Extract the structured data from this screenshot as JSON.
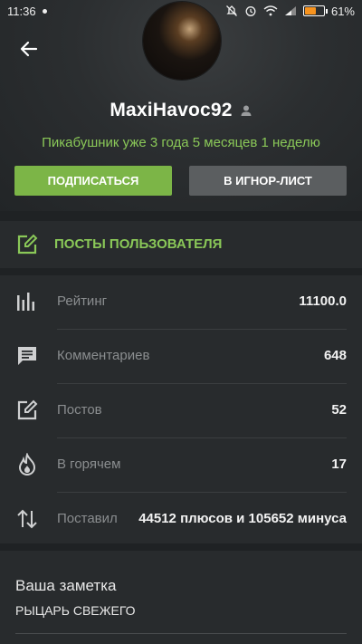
{
  "status_bar": {
    "time": "11:36",
    "battery_percent": "61%",
    "battery_level": 0.61,
    "battery_color": "#f7931e"
  },
  "profile": {
    "username": "MaxiHavoc92",
    "membership": "Пикабушник уже 3 года 5 месяцев 1 неделю",
    "subscribe_label": "ПОДПИСАТЬСЯ",
    "ignore_label": "В ИГНОР-ЛИСТ"
  },
  "posts_link": {
    "label": "ПОСТЫ ПОЛЬЗОВАТЕЛЯ"
  },
  "stats": [
    {
      "label": "Рейтинг",
      "value": "11100.0",
      "icon": "rating-bars-icon"
    },
    {
      "label": "Комментариев",
      "value": "648",
      "icon": "comment-icon"
    },
    {
      "label": "Постов",
      "value": "52",
      "icon": "edit-post-icon"
    },
    {
      "label": "В горячем",
      "value": "17",
      "icon": "flame-icon"
    },
    {
      "label": "Поставил",
      "value": "44512 плюсов и 105652 минуса",
      "icon": "up-down-arrows-icon"
    }
  ],
  "note": {
    "title": "Ваша заметка",
    "text": "РЫЦАРЬ СВЕЖЕГО"
  },
  "colors": {
    "accent_green": "#8ac858",
    "subscribe_button": "#7cb547",
    "ignore_button": "#5b5e60",
    "background": "#1f2224",
    "panel": "#282b2d"
  }
}
